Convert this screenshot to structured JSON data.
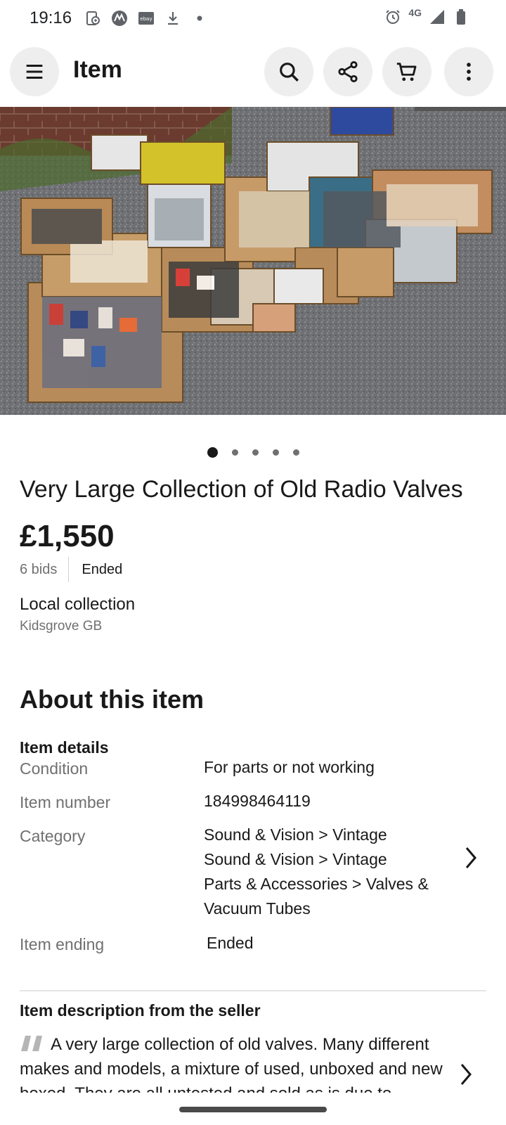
{
  "status_bar": {
    "time": "19:16",
    "left_icons": [
      "sync-icon",
      "motorola-icon",
      "ebay-icon",
      "download-icon",
      "dot-icon"
    ],
    "network": "4G",
    "right_icons": [
      "alarm-icon",
      "signal-icon",
      "battery-icon"
    ]
  },
  "header": {
    "title": "Item",
    "buttons": [
      "menu-icon",
      "search-icon",
      "share-icon",
      "cart-icon",
      "more-vert-icon"
    ]
  },
  "gallery": {
    "image_count": 5,
    "active_index": 0
  },
  "item": {
    "title": "Very Large Collection of Old Radio Valves",
    "price": "£1,550",
    "bids": "6 bids",
    "status": "Ended",
    "shipping": "Local collection",
    "location": "Kidsgrove GB"
  },
  "about": {
    "heading": "About this item",
    "details_heading": "Item details",
    "condition_label": "Condition",
    "condition_value": "For parts or not working",
    "item_number_label": "Item number",
    "item_number_value": "184998464119",
    "category_label": "Category",
    "category_lines": [
      "Sound & Vision > Vintage",
      "Sound & Vision > Vintage",
      "Parts & Accessories > Valves &",
      "Vacuum Tubes"
    ],
    "ending_label": "Item ending",
    "ending_value": "Ended"
  },
  "description": {
    "heading": "Item description from the seller",
    "text": "A very large collection of old valves. Many different makes and models, a mixture of used, unboxed and new boxed. They are all untested and sold as is due to"
  },
  "colors": {
    "text_primary": "#191919",
    "text_secondary": "#707070",
    "button_bg": "#eeeeee",
    "divider": "#e5e5e5"
  }
}
